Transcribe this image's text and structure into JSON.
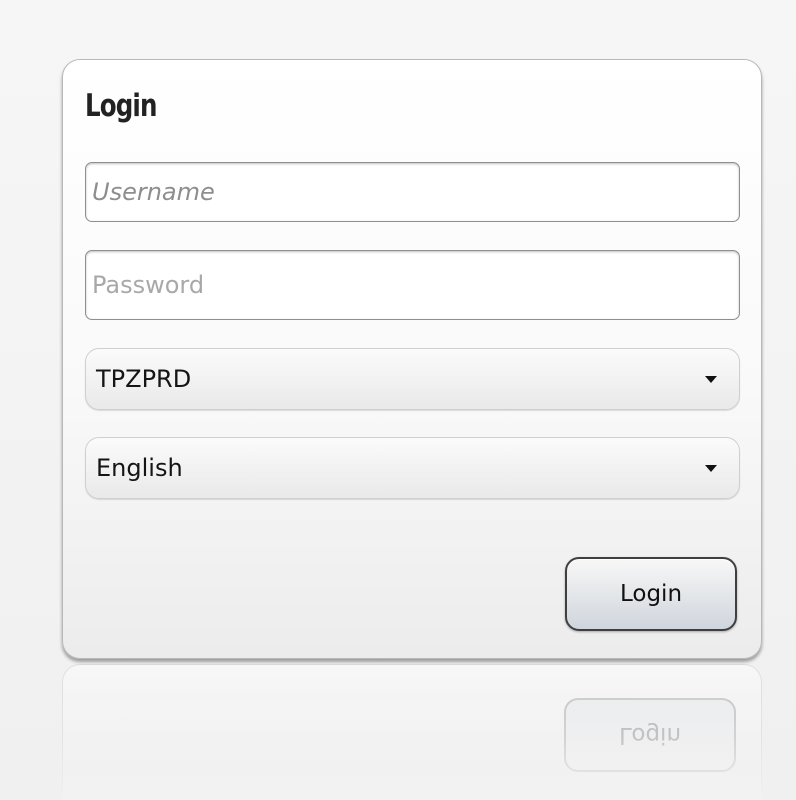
{
  "login_form": {
    "title": "Login",
    "username_placeholder": "Username",
    "username_value": "",
    "password_placeholder": "Password",
    "password_value": "",
    "database_selected": "TPZPRD",
    "language_selected": "English",
    "submit_label": "Login",
    "reflection_label": "Login"
  },
  "icons": {
    "dropdown_caret": "chevron-down-icon"
  }
}
